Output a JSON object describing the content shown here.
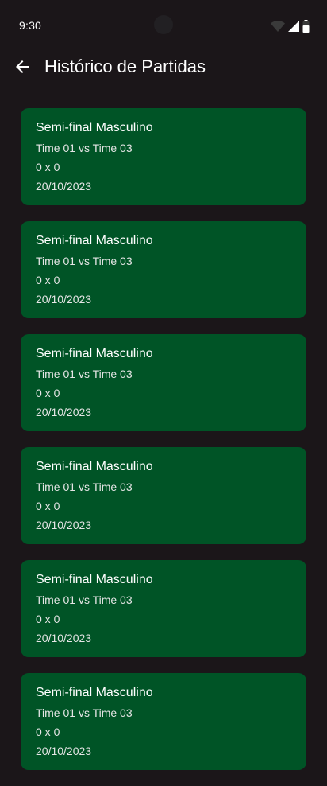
{
  "status_bar": {
    "time": "9:30",
    "icons": [
      "wifi-icon",
      "cellular-signal-icon",
      "battery-icon"
    ]
  },
  "app_bar": {
    "back_icon": "arrow-back-icon",
    "title": "Histórico de Partidas"
  },
  "colors": {
    "background": "#1b1619",
    "card": "#005426",
    "text": "#ffffff"
  },
  "matches": [
    {
      "title": "Semi-final Masculino",
      "teams": "Time 01 vs Time 03",
      "score": "0 x 0",
      "date": "20/10/2023"
    },
    {
      "title": "Semi-final Masculino",
      "teams": "Time 01 vs Time 03",
      "score": "0 x 0",
      "date": "20/10/2023"
    },
    {
      "title": "Semi-final Masculino",
      "teams": "Time 01 vs Time 03",
      "score": "0 x 0",
      "date": "20/10/2023"
    },
    {
      "title": "Semi-final Masculino",
      "teams": "Time 01 vs Time 03",
      "score": "0 x 0",
      "date": "20/10/2023"
    },
    {
      "title": "Semi-final Masculino",
      "teams": "Time 01 vs Time 03",
      "score": "0 x 0",
      "date": "20/10/2023"
    },
    {
      "title": "Semi-final Masculino",
      "teams": "Time 01 vs Time 03",
      "score": "0 x 0",
      "date": "20/10/2023"
    }
  ]
}
